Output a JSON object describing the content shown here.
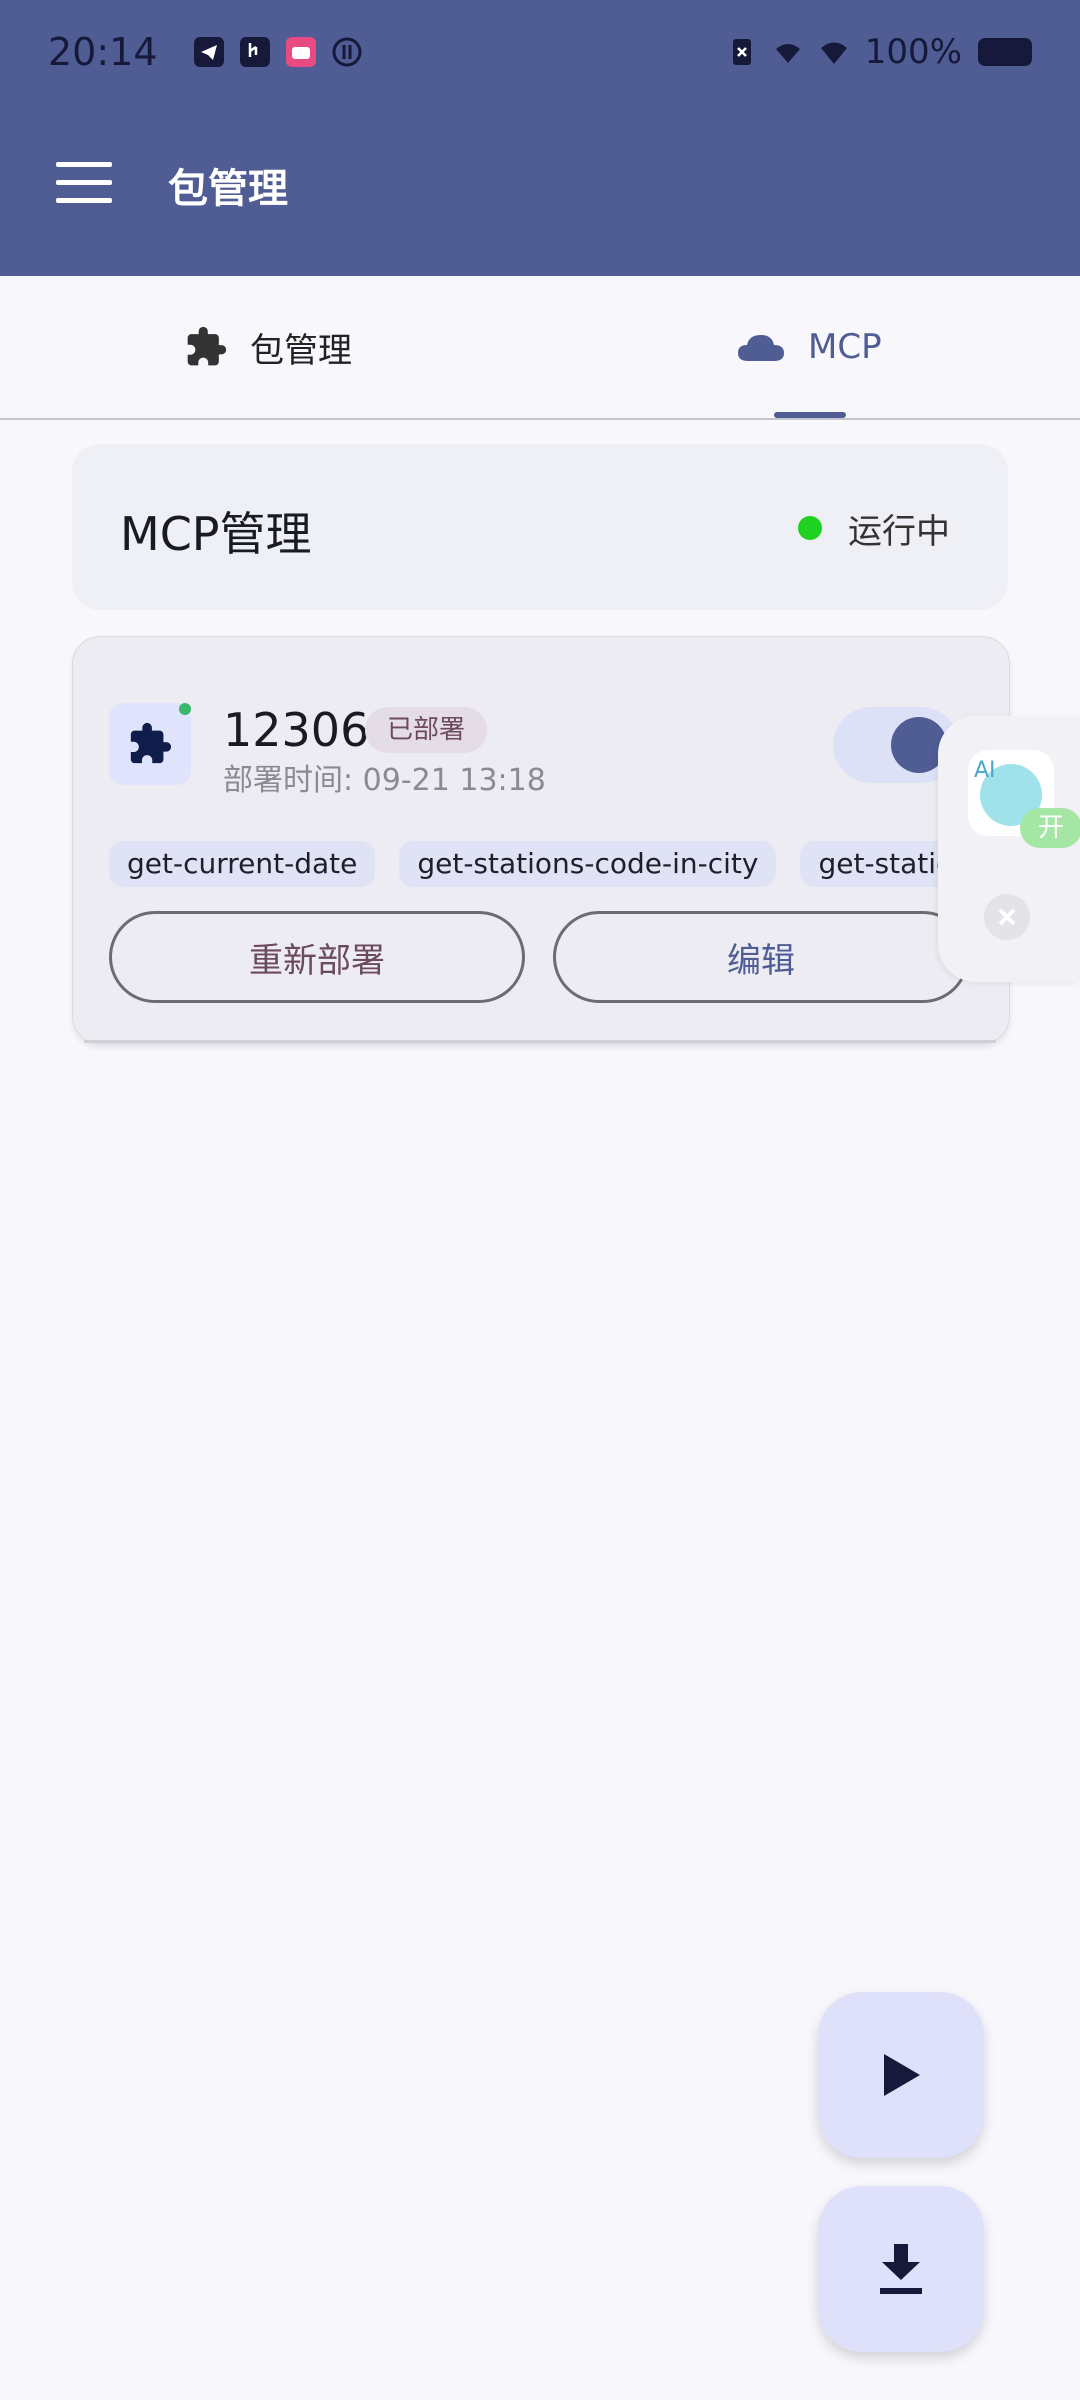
{
  "status_bar": {
    "time": "20:14",
    "battery": "100%",
    "left_icons": [
      "telegram-icon",
      "usb-debug-icon",
      "bilibili-icon",
      "game-icon"
    ],
    "right_icons": [
      "no-sim-icon",
      "mobile-data-icon",
      "wifi-icon",
      "battery-icon"
    ]
  },
  "app_bar": {
    "title": "包管理"
  },
  "tabs": [
    {
      "label": "包管理",
      "icon": "puzzle-icon",
      "selected": false
    },
    {
      "label": "MCP",
      "icon": "cloud-icon",
      "selected": true
    }
  ],
  "mcp_header": {
    "title": "MCP管理",
    "status": "运行中",
    "status_color": "#1fd21f"
  },
  "package": {
    "name": "12306",
    "badge": "已部署",
    "deploy_time": "部署时间: 09-21 13:18",
    "enabled": true,
    "tools": [
      "get-current-date",
      "get-stations-code-in-city",
      "get-statio"
    ],
    "redeploy_label": "重新部署",
    "edit_label": "编辑"
  },
  "floating_assistant": {
    "ai_label": "AI",
    "state_label": "开"
  },
  "colors": {
    "primary": "#4f5d94",
    "background": "#f7f7fc",
    "running": "#1fd21f"
  }
}
